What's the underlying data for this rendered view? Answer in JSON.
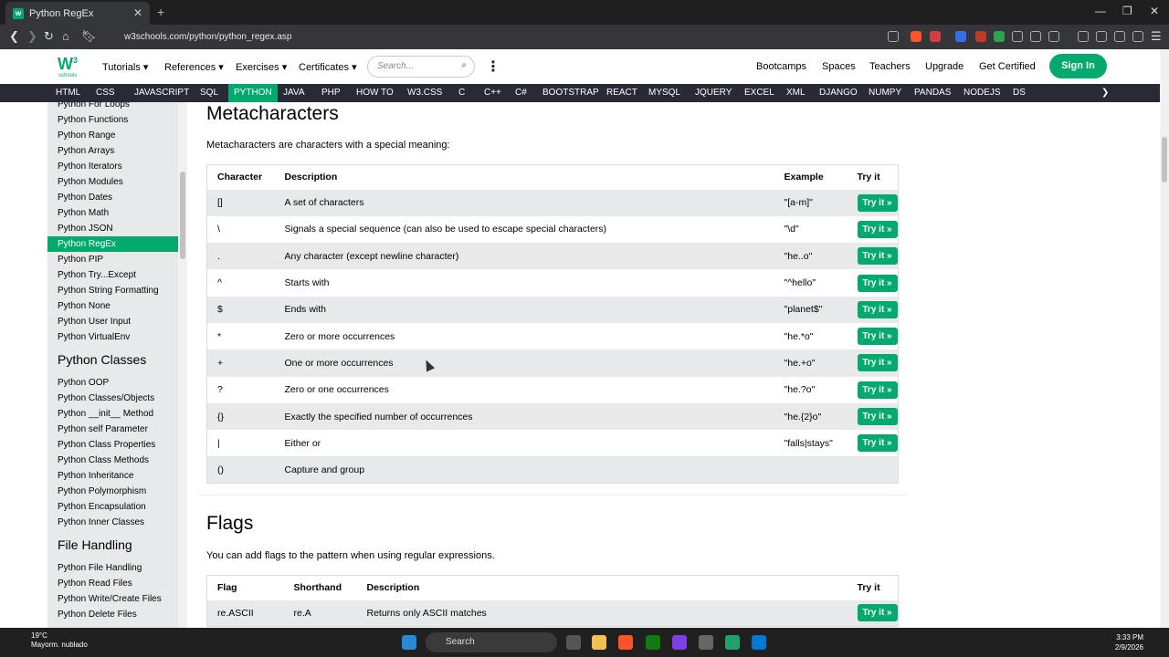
{
  "browser": {
    "tab_title": "Python RegEx",
    "url": "w3schools.com/python/python_regex.asp"
  },
  "header": {
    "logo_sub": "schools",
    "menus": [
      "Tutorials ▾",
      "References ▾",
      "Exercises ▾",
      "Certificates ▾"
    ],
    "search_placeholder": "Search...",
    "right_links": [
      "Bootcamps",
      "Spaces",
      "Teachers",
      "Upgrade",
      "Get Certified"
    ],
    "signin": "Sign In"
  },
  "topnav": [
    "HTML",
    "CSS",
    "JAVASCRIPT",
    "SQL",
    "PYTHON",
    "JAVA",
    "PHP",
    "HOW TO",
    "W3.CSS",
    "C",
    "C++",
    "C#",
    "BOOTSTRAP",
    "REACT",
    "MYSQL",
    "JQUERY",
    "EXCEL",
    "XML",
    "DJANGO",
    "NUMPY",
    "PANDAS",
    "NODEJS",
    "DS"
  ],
  "sidebar": {
    "group1": [
      "Python For Loops",
      "Python Functions",
      "Python Range",
      "Python Arrays",
      "Python Iterators",
      "Python Modules",
      "Python Dates",
      "Python Math",
      "Python JSON",
      "Python RegEx",
      "Python PIP",
      "Python Try...Except",
      "Python String Formatting",
      "Python None",
      "Python User Input",
      "Python VirtualEnv"
    ],
    "heading2": "Python Classes",
    "group2": [
      "Python OOP",
      "Python Classes/Objects",
      "Python __init__ Method",
      "Python self Parameter",
      "Python Class Properties",
      "Python Class Methods",
      "Python Inheritance",
      "Python Polymorphism",
      "Python Encapsulation",
      "Python Inner Classes"
    ],
    "heading3": "File Handling",
    "group3": [
      "Python File Handling",
      "Python Read Files",
      "Python Write/Create Files",
      "Python Delete Files"
    ]
  },
  "main": {
    "meta_title": "Metacharacters",
    "meta_desc": "Metacharacters are characters with a special meaning:",
    "meta_headers": [
      "Character",
      "Description",
      "Example",
      "Try it"
    ],
    "meta_rows": [
      {
        "c": "[]",
        "d": "A set of characters",
        "e": "\"[a-m]\"",
        "t": "Try it »"
      },
      {
        "c": "\\",
        "d": "Signals a special sequence (can also be used to escape special characters)",
        "e": "\"\\d\"",
        "t": "Try it »"
      },
      {
        "c": ".",
        "d": "Any character (except newline character)",
        "e": "\"he..o\"",
        "t": "Try it »"
      },
      {
        "c": "^",
        "d": "Starts with",
        "e": "\"^hello\"",
        "t": "Try it »"
      },
      {
        "c": "$",
        "d": "Ends with",
        "e": "\"planet$\"",
        "t": "Try it »"
      },
      {
        "c": "*",
        "d": "Zero or more occurrences",
        "e": "\"he.*o\"",
        "t": "Try it »"
      },
      {
        "c": "+",
        "d": "One or more occurrences",
        "e": "\"he.+o\"",
        "t": "Try it »"
      },
      {
        "c": "?",
        "d": "Zero or one occurrences",
        "e": "\"he.?o\"",
        "t": "Try it »"
      },
      {
        "c": "{}",
        "d": "Exactly the specified number of occurrences",
        "e": "\"he.{2}o\"",
        "t": "Try it »"
      },
      {
        "c": "|",
        "d": "Either or",
        "e": "\"falls|stays\"",
        "t": "Try it »"
      },
      {
        "c": "()",
        "d": "Capture and group",
        "e": "",
        "t": ""
      }
    ],
    "flags_title": "Flags",
    "flags_desc": "You can add flags to the pattern when using regular expressions.",
    "flags_headers": [
      "Flag",
      "Shorthand",
      "Description",
      "Try it"
    ],
    "flags_rows": [
      {
        "f": "re.ASCII",
        "s": "re.A",
        "d": "Returns only ASCII matches",
        "t": "Try it »"
      }
    ]
  },
  "taskbar": {
    "temp": "19°C",
    "weather": "Mayorm. nublado",
    "search": "Search",
    "time": "3:33 PM",
    "date": "2/9/2026"
  },
  "colors": {
    "accent": "#04aa6d",
    "nav": "#282a35",
    "sidebar": "#e7e9eb"
  }
}
